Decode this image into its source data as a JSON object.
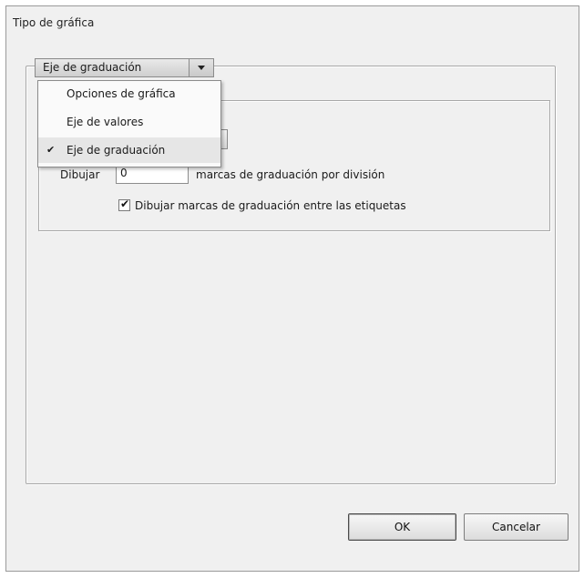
{
  "dialog": {
    "title": "Tipo de gráfica"
  },
  "section_select": {
    "selected": "Eje de graduación"
  },
  "menu": {
    "items": [
      {
        "label": "Opciones de gráfica",
        "checked": false
      },
      {
        "label": "Eje de valores",
        "checked": false
      },
      {
        "label": "Eje de graduación",
        "checked": true
      }
    ],
    "check_glyph": "✔"
  },
  "tick_settings": {
    "draw_label": "Dibujar",
    "count_value": "0",
    "count_suffix": "marcas de graduación por división",
    "between_labels_checkbox": {
      "label": "Dibujar marcas de graduación entre las etiquetas",
      "checked": true,
      "glyph": "✔"
    }
  },
  "buttons": {
    "ok": "OK",
    "cancel": "Cancelar"
  }
}
